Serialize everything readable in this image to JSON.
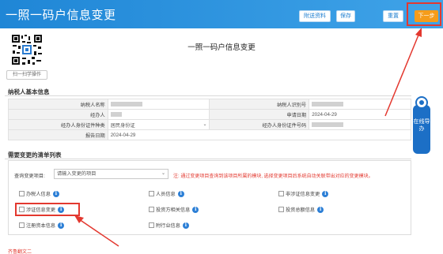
{
  "header": {
    "title": "一照一码户信息变更",
    "buttons": {
      "prev": "附送资料",
      "save": "保存",
      "reset": "重置",
      "next": "下一步"
    }
  },
  "qr": {
    "caption": "扫一扫学操作"
  },
  "page": {
    "title": "一照一码户信息变更"
  },
  "taxpayer": {
    "section_title": "纳税人基本信息",
    "rows": [
      {
        "l1": "纳税人名称",
        "v1": "",
        "l2": "纳税人识别号",
        "v2": ""
      },
      {
        "l1": "经办人",
        "v1": "",
        "l2": "申请日期",
        "v2": "2024-04-29"
      },
      {
        "l1": "经办人身份证件种类",
        "v1": "居民身份证",
        "l2": "经办人身份证件号码",
        "v2": ""
      },
      {
        "l1": "报告日期",
        "v1": "2024-04-29",
        "l2": "",
        "v2": ""
      }
    ]
  },
  "changes": {
    "section_title": "需要变更的清单列表",
    "filter_label": "查询变更项目:",
    "filter_value": "请输入变更的项目",
    "note": "注: 通过变更项目查询到该项目所属的模块, 选择变更项目后系统自动关联带出对应的变更模块。",
    "items": [
      {
        "label": "办税人信息"
      },
      {
        "label": "人员信息"
      },
      {
        "label": "非涉证信息变更"
      },
      {
        "label": "涉证信息变更"
      },
      {
        "label": "投资方相关信息"
      },
      {
        "label": "投资总额信息"
      },
      {
        "label": "注册资本信息"
      },
      {
        "label": "附行业信息"
      }
    ]
  },
  "side_widget": {
    "text": "在线导办"
  },
  "footer": {
    "text": "齐鲁翻文二"
  },
  "colors": {
    "header_blue": "#1f86d6",
    "next_orange": "#f59c1a",
    "annotation_red": "#e3382f",
    "info_blue": "#2c7fd6"
  }
}
